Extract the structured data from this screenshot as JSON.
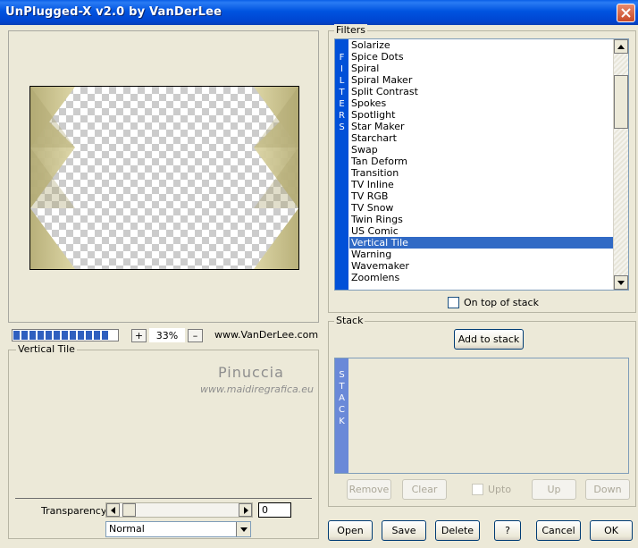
{
  "window": {
    "title": "UnPlugged-X v2.0 by VanDerLee"
  },
  "preview": {
    "progress_segments": 12
  },
  "zoom": {
    "plus": "+",
    "minus": "–",
    "value": "33%"
  },
  "site": {
    "text": "www.VanDerLee.com"
  },
  "settings": {
    "title": "Vertical Tile",
    "watermark_name": "Pinuccia",
    "watermark_url": "www.maidiregrafica.eu",
    "transparency_label": "Transparency",
    "transparency_value": "0",
    "blend_mode": "Normal"
  },
  "filters": {
    "group_label": "Filters",
    "vertical_label": [
      "F",
      "I",
      "L",
      "T",
      "E",
      "R",
      "S"
    ],
    "items": [
      "Solarize",
      "Spice Dots",
      "Spiral",
      "Spiral Maker",
      "Split Contrast",
      "Spokes",
      "Spotlight",
      "Star Maker",
      "Starchart",
      "Swap",
      "Tan Deform",
      "Transition",
      "TV Inline",
      "TV RGB",
      "TV Snow",
      "Twin Rings",
      "US Comic",
      "Vertical Tile",
      "Warning",
      "Wavemaker",
      "Zoomlens"
    ],
    "selected": "Vertical Tile",
    "on_top_label": "On top of stack"
  },
  "stack": {
    "group_label": "Stack",
    "add_button": "Add to stack",
    "vertical_label": [
      "S",
      "T",
      "A",
      "C",
      "K"
    ],
    "remove": "Remove",
    "clear": "Clear",
    "upto": "Upto",
    "up": "Up",
    "down": "Down"
  },
  "buttons": {
    "open": "Open",
    "save": "Save",
    "delete": "Delete",
    "help": "?",
    "cancel": "Cancel",
    "ok": "OK"
  },
  "colors": {
    "titlebar": "#0055e5",
    "selection": "#316ac5",
    "filters_bar": "#0050d8",
    "stack_bar": "#6a89d8",
    "tile": "#c8c08a"
  }
}
